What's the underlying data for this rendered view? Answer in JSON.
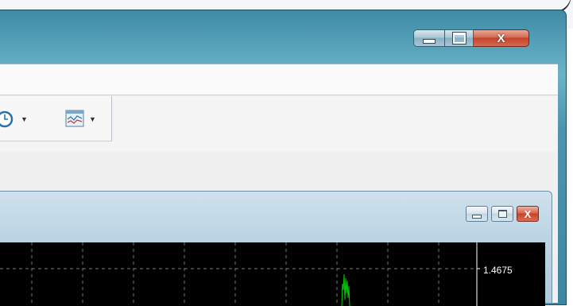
{
  "window": {
    "caption_buttons": [
      "minimize",
      "maximize",
      "close"
    ],
    "close_label": "X"
  },
  "toolbar": {
    "icons": [
      "clock-icon",
      "indicators-icon"
    ]
  },
  "chart_window": {
    "caption_buttons": [
      "minimize",
      "maximize",
      "close"
    ],
    "close_label": "X"
  },
  "chart": {
    "background": "#000000",
    "price_label": "1.4675",
    "line_color": "#00cc00"
  }
}
